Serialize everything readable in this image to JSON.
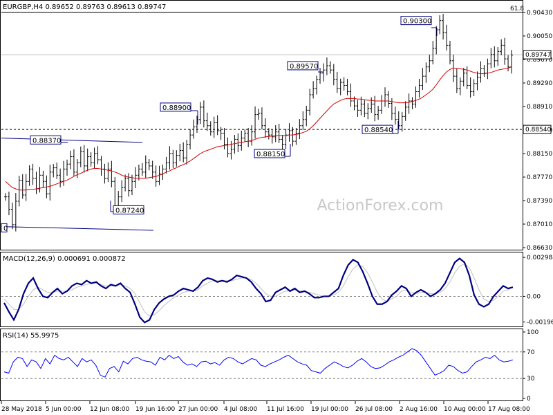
{
  "symbol_header": "EURGBP,H4  0.89652 0.89763 0.89613 0.89747",
  "watermark": "ActionForex.com",
  "colors": {
    "price": "#000000",
    "ma": "#d40000",
    "macd": "#000080",
    "signal": "#c0c0c0",
    "rsi": "#0000ff",
    "grid": "#c0c0c0"
  },
  "chart_data": [
    {
      "type": "line",
      "panel": "price",
      "ylim": [
        0.8663,
        0.9043
      ],
      "ytick_labels": [
        "0.90430",
        "0.90050",
        "0.89670",
        "0.89290",
        "0.88910",
        "0.88530",
        "0.88150",
        "0.87770",
        "0.87390",
        "0.87010",
        "0.86630"
      ],
      "yticks": [
        0.9043,
        0.9005,
        0.8967,
        0.8929,
        0.8891,
        0.8853,
        0.8815,
        0.8777,
        0.8739,
        0.8701,
        0.8663
      ],
      "current_price": 0.89747,
      "current_price_label": "0.89747",
      "hline_value": 0.8854,
      "hline_label": "0.88540",
      "fib_level": 0.9043,
      "fib_label": "61.8",
      "series": [
        {
          "x": [
            0,
            5,
            10,
            15,
            20,
            25,
            30,
            35,
            40,
            45,
            50,
            55,
            60,
            65,
            70,
            75,
            80,
            85,
            90,
            95,
            100,
            105,
            110,
            115,
            120,
            125,
            130,
            135,
            140,
            145,
            150,
            155,
            160,
            165,
            170,
            175,
            180,
            185,
            190,
            195,
            200,
            205,
            210,
            215,
            220,
            225,
            230,
            235,
            240,
            245,
            250,
            255,
            260,
            265,
            270,
            275,
            280,
            285,
            290,
            295,
            300,
            305,
            310,
            315,
            320,
            325,
            330,
            335,
            340,
            345,
            350,
            355,
            360,
            365,
            370,
            375,
            380,
            385,
            390,
            395,
            400,
            405,
            410,
            415,
            420,
            425,
            430,
            435,
            440,
            445,
            450,
            455,
            460,
            465,
            470,
            475,
            480,
            485,
            490,
            495,
            500,
            505,
            510,
            515,
            520,
            525,
            530,
            535,
            540,
            545,
            550,
            555,
            560,
            565,
            570,
            575,
            580,
            585,
            590,
            595,
            600,
            605,
            610,
            615,
            620,
            625,
            630,
            635,
            640,
            645,
            650,
            655,
            660,
            665,
            670,
            675,
            680,
            685,
            690,
            695,
            700,
            705,
            710,
            715,
            720,
            725,
            730,
            735,
            740
          ],
          "values": [
            0.8745,
            0.8725,
            0.87,
            0.8738,
            0.8772,
            0.8748,
            0.877,
            0.879,
            0.8775,
            0.8758,
            0.878,
            0.877,
            0.875,
            0.8785,
            0.8792,
            0.878,
            0.877,
            0.879,
            0.8798,
            0.881,
            0.8785,
            0.88,
            0.8818,
            0.8795,
            0.881,
            0.88,
            0.8815,
            0.8805,
            0.879,
            0.8775,
            0.879,
            0.877,
            0.873,
            0.8745,
            0.876,
            0.8775,
            0.8755,
            0.877,
            0.878,
            0.879,
            0.8785,
            0.88,
            0.8795,
            0.8785,
            0.877,
            0.8782,
            0.879,
            0.88,
            0.8815,
            0.88,
            0.8812,
            0.882,
            0.8808,
            0.883,
            0.8845,
            0.8858,
            0.887,
            0.889,
            0.8868,
            0.886,
            0.885,
            0.8865,
            0.8852,
            0.8848,
            0.883,
            0.8815,
            0.8822,
            0.8838,
            0.8828,
            0.884,
            0.8848,
            0.8835,
            0.885,
            0.8878,
            0.888,
            0.886,
            0.885,
            0.8845,
            0.8842,
            0.885,
            0.8838,
            0.883,
            0.8845,
            0.8852,
            0.8835,
            0.8848,
            0.886,
            0.887,
            0.8885,
            0.891,
            0.892,
            0.8935,
            0.8945,
            0.895,
            0.8957,
            0.895,
            0.8935,
            0.892,
            0.893,
            0.8925,
            0.8915,
            0.89,
            0.8892,
            0.8885,
            0.8895,
            0.888,
            0.8888,
            0.8895,
            0.8878,
            0.8885,
            0.89,
            0.891,
            0.8896,
            0.888,
            0.887,
            0.886,
            0.8875,
            0.889,
            0.89,
            0.8895,
            0.8915,
            0.8925,
            0.894,
            0.8955,
            0.8965,
            0.8985,
            0.9015,
            0.903,
            0.901,
            0.899,
            0.8965,
            0.894,
            0.892,
            0.8932,
            0.8945,
            0.8925,
            0.8915,
            0.8928,
            0.8938,
            0.8952,
            0.8945,
            0.896,
            0.8975,
            0.8965,
            0.898,
            0.899,
            0.8968,
            0.8955,
            0.8974
          ]
        },
        {
          "values": [
            0.877,
            0.8765,
            0.876,
            0.8758,
            0.8756,
            0.8756,
            0.8756,
            0.8757,
            0.8757,
            0.8758,
            0.8759,
            0.876,
            0.8761,
            0.8762,
            0.8764,
            0.8766,
            0.8768,
            0.877,
            0.8772,
            0.8775,
            0.8778,
            0.8781,
            0.8783,
            0.8786,
            0.8788,
            0.879,
            0.8791,
            0.8791,
            0.879,
            0.8789,
            0.8788,
            0.8787,
            0.8785,
            0.8783,
            0.878,
            0.8778,
            0.8777,
            0.8776,
            0.8775,
            0.8775,
            0.8775,
            0.8775,
            0.8776,
            0.8777,
            0.8778,
            0.878,
            0.8782,
            0.8785,
            0.8787,
            0.879,
            0.8792,
            0.8795,
            0.8797,
            0.88,
            0.8803,
            0.8807,
            0.8811,
            0.8815,
            0.8818,
            0.882,
            0.8822,
            0.8824,
            0.8826,
            0.8827,
            0.8828,
            0.8829,
            0.883,
            0.8831,
            0.8832,
            0.8833,
            0.8834,
            0.8835,
            0.8836,
            0.8838,
            0.884,
            0.8841,
            0.8842,
            0.8843,
            0.8843,
            0.8844,
            0.8844,
            0.8844,
            0.8844,
            0.8845,
            0.8845,
            0.8846,
            0.8847,
            0.8849,
            0.8851,
            0.8855,
            0.886,
            0.8866,
            0.8872,
            0.8878,
            0.8884,
            0.889,
            0.8895,
            0.8898,
            0.8901,
            0.8903,
            0.8904,
            0.8904,
            0.8904,
            0.8903,
            0.8903,
            0.8902,
            0.8901,
            0.8901,
            0.89,
            0.89,
            0.89,
            0.89,
            0.89,
            0.8899,
            0.8898,
            0.8897,
            0.8897,
            0.8897,
            0.8898,
            0.8899,
            0.8901,
            0.8903,
            0.8906,
            0.891,
            0.8914,
            0.8919,
            0.8926,
            0.8934,
            0.8941,
            0.8947,
            0.8951,
            0.8953,
            0.8953,
            0.8952,
            0.8951,
            0.895,
            0.8948,
            0.8946,
            0.8945,
            0.8944,
            0.8944,
            0.8945,
            0.8946,
            0.8948,
            0.895,
            0.8951,
            0.8952,
            0.8953,
            0.8955
          ]
        }
      ],
      "annotations": [
        {
          "text": "0.88370",
          "value": 0.8837
        },
        {
          "text": "0.87240",
          "value": 0.8724
        },
        {
          "text": "0.88900",
          "value": 0.889
        },
        {
          "text": "0.88150",
          "value": 0.8815
        },
        {
          "text": "0.89570",
          "value": 0.8957
        },
        {
          "text": "0.88540",
          "value": 0.8854
        },
        {
          "text": "0.90300",
          "value": 0.903
        },
        {
          "text": "0",
          "value": 0.8695
        }
      ],
      "trendlines": [
        {
          "value_start": 0.884,
          "value_end": 0.8833
        },
        {
          "value_start": 0.8697,
          "value_end": 0.8691
        }
      ]
    },
    {
      "type": "line",
      "panel": "macd",
      "title": "MACD(12,26,9) 0.000691 0.000872",
      "ylim": [
        -0.0022,
        0.0032
      ],
      "ytick_labels": [
        "0.002984",
        "0.00",
        "-0.00196"
      ],
      "yticks": [
        0.002984,
        0.0,
        -0.00196
      ],
      "zero_line": 0,
      "macd": [
        -0.0005,
        -0.0012,
        -0.0018,
        -0.001,
        0.0002,
        0.001,
        0.0014,
        0.0006,
        0.0,
        -0.0001,
        0.0003,
        0.0006,
        0.0002,
        0.0004,
        0.0008,
        0.001,
        0.0009,
        0.0012,
        0.001,
        0.0011,
        0.0008,
        0.0006,
        0.0009,
        0.0008,
        0.001,
        0.0006,
        0.0003,
        -0.0006,
        -0.0016,
        -0.002,
        -0.0018,
        -0.001,
        -0.0005,
        -0.0002,
        0.0,
        0.0001,
        0.0004,
        0.0006,
        0.0005,
        0.0004,
        0.0007,
        0.0012,
        0.0014,
        0.0013,
        0.0011,
        0.0012,
        0.0011,
        0.0013,
        0.0016,
        0.0015,
        0.0014,
        0.0011,
        0.0006,
        0.0002,
        -0.0004,
        -0.0003,
        0.0003,
        0.0005,
        0.0007,
        0.0004,
        0.0006,
        0.0003,
        0.0004,
        0.0002,
        -0.0001,
        -0.0001,
        0.0,
        0.0,
        0.0003,
        0.0006,
        0.0016,
        0.0024,
        0.0028,
        0.0026,
        0.0019,
        0.001,
        0.0,
        -0.0006,
        -0.0006,
        -0.0004,
        0.0001,
        0.0004,
        0.0008,
        0.0006,
        0.0,
        0.0003,
        0.0005,
        0.0003,
        0.0,
        0.0002,
        0.0005,
        0.001,
        0.0018,
        0.0026,
        0.0029,
        0.0026,
        0.0016,
        0.0001,
        -0.0006,
        -0.0008,
        -0.0006,
        0.0,
        0.0004,
        0.0008,
        0.0006,
        0.0007
      ],
      "signal": [
        -0.0002,
        -0.0006,
        -0.001,
        -0.001,
        -0.0006,
        0.0,
        0.0005,
        0.0007,
        0.0005,
        0.0003,
        0.0003,
        0.0004,
        0.0004,
        0.0004,
        0.0005,
        0.0007,
        0.0008,
        0.0009,
        0.001,
        0.001,
        0.0009,
        0.0008,
        0.0008,
        0.0008,
        0.0009,
        0.0008,
        0.0006,
        0.0002,
        -0.0005,
        -0.0012,
        -0.0015,
        -0.0014,
        -0.0011,
        -0.0007,
        -0.0004,
        -0.0001,
        0.0001,
        0.0003,
        0.0004,
        0.0004,
        0.0005,
        0.0008,
        0.001,
        0.0012,
        0.0012,
        0.0012,
        0.0012,
        0.0012,
        0.0013,
        0.0014,
        0.0014,
        0.0013,
        0.001,
        0.0006,
        0.0002,
        0.0,
        0.0,
        0.0002,
        0.0004,
        0.0004,
        0.0005,
        0.0004,
        0.0004,
        0.0003,
        0.0002,
        0.0001,
        0.0,
        0.0,
        0.0001,
        0.0003,
        0.0008,
        0.0015,
        0.0021,
        0.0024,
        0.0023,
        0.0018,
        0.0011,
        0.0003,
        -0.0002,
        -0.0004,
        -0.0002,
        0.0,
        0.0004,
        0.0005,
        0.0003,
        0.0002,
        0.0003,
        0.0003,
        0.0002,
        0.0002,
        0.0003,
        0.0006,
        0.0011,
        0.0018,
        0.0023,
        0.0025,
        0.0022,
        0.0014,
        0.0005,
        -0.0002,
        -0.0004,
        -0.0003,
        0.0,
        0.0004,
        0.0005,
        0.0007
      ]
    },
    {
      "type": "line",
      "panel": "rsi",
      "title": "RSI(14) 55.9975",
      "ylim": [
        0,
        100
      ],
      "ytick_labels": [
        "100",
        "70",
        "30",
        "0"
      ],
      "yticks": [
        100,
        70,
        30,
        0
      ],
      "levels": [
        70,
        30
      ],
      "values": [
        40,
        38,
        55,
        62,
        60,
        48,
        58,
        55,
        45,
        60,
        52,
        65,
        60,
        58,
        62,
        55,
        48,
        60,
        55,
        58,
        50,
        35,
        32,
        45,
        48,
        40,
        56,
        52,
        60,
        62,
        58,
        56,
        55,
        50,
        62,
        58,
        65,
        60,
        63,
        55,
        50,
        52,
        48,
        55,
        56,
        52,
        54,
        50,
        58,
        62,
        60,
        55,
        52,
        56,
        60,
        58,
        50,
        48,
        52,
        55,
        58,
        62,
        65,
        60,
        55,
        52,
        50,
        42,
        40,
        38,
        45,
        50,
        55,
        52,
        48,
        46,
        50,
        56,
        60,
        55,
        48,
        45,
        46,
        50,
        55,
        58,
        62,
        65,
        70,
        75,
        72,
        65,
        55,
        45,
        35,
        38,
        42,
        50,
        48,
        42,
        38,
        40,
        48,
        55,
        58,
        62,
        60,
        65,
        58,
        55,
        56,
        58
      ]
    },
    {
      "type": "axis",
      "panel": "time",
      "x_labels": [
        "28 May 2018",
        "5 Jun 00:00",
        "12 Jun 08:00",
        "19 Jun 16:00",
        "27 Jun 00:00",
        "4 Jul 08:00",
        "11 Jul 16:00",
        "19 Jul 00:00",
        "26 Jul 08:00",
        "2 Aug 16:00",
        "10 Aug 00:00",
        "17 Aug 08:00"
      ]
    }
  ]
}
